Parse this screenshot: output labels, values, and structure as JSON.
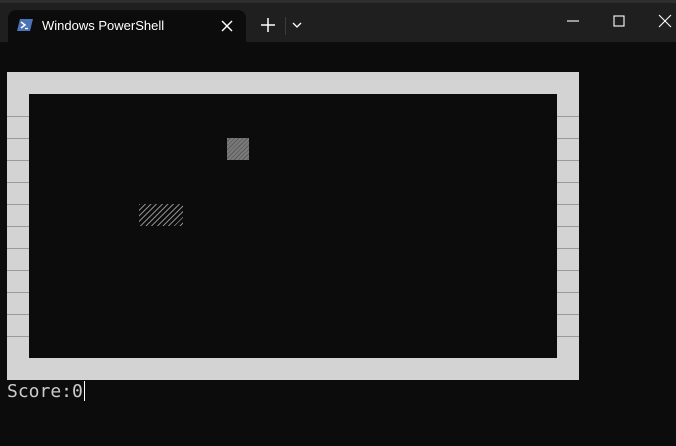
{
  "window": {
    "tab_title": "Windows PowerShell",
    "tab_icon": "powershell-icon",
    "new_tab_icon": "plus-icon",
    "dropdown_icon": "chevron-down-icon",
    "minimize_icon": "minimize-icon",
    "maximize_icon": "maximize-icon",
    "close_icon": "close-icon"
  },
  "terminal": {
    "score_label": "Score:",
    "score_value": "0"
  },
  "colors": {
    "background": "#0c0c0c",
    "titlebar": "#1f1f1f",
    "border": "#d3d3d3",
    "text": "#cccccc"
  }
}
